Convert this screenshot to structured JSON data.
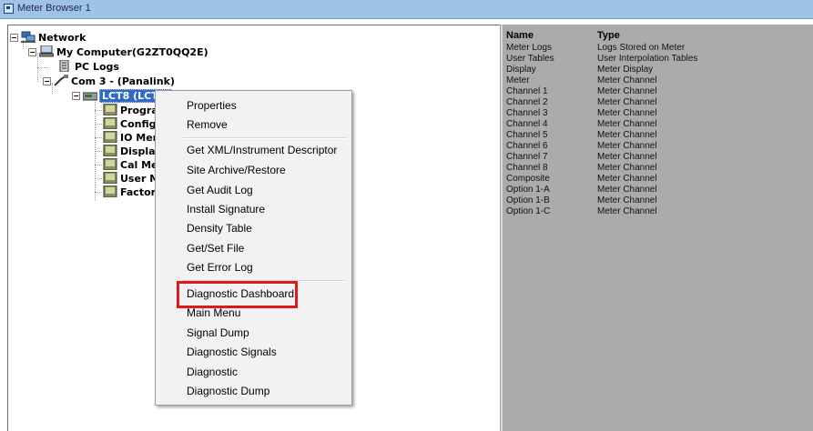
{
  "window": {
    "title": "Meter Browser 1"
  },
  "tree": {
    "network": "Network",
    "computer": "My Computer(G2ZT0QQ2E)",
    "pc_logs": "PC Logs",
    "com": "Com 3 -  (Panalink)",
    "lct": "LCT8 (LCT8)",
    "children": [
      "Progra",
      "Config",
      "IO Mer",
      "Display",
      "Cal Me",
      "User M",
      "Factor"
    ]
  },
  "list": {
    "header_name": "Name",
    "header_type": "Type",
    "rows": [
      {
        "name": "Meter Logs",
        "type": "Logs Stored on Meter"
      },
      {
        "name": "User Tables",
        "type": "User Interpolation Tables"
      },
      {
        "name": "Display",
        "type": "Meter Display"
      },
      {
        "name": "Meter",
        "type": "Meter Channel"
      },
      {
        "name": "Channel 1",
        "type": "Meter Channel"
      },
      {
        "name": "Channel 2",
        "type": "Meter Channel"
      },
      {
        "name": "Channel 3",
        "type": "Meter Channel"
      },
      {
        "name": "Channel 4",
        "type": "Meter Channel"
      },
      {
        "name": "Channel 5",
        "type": "Meter Channel"
      },
      {
        "name": "Channel 6",
        "type": "Meter Channel"
      },
      {
        "name": "Channel 7",
        "type": "Meter Channel"
      },
      {
        "name": "Channel 8",
        "type": "Meter Channel"
      },
      {
        "name": "Composite",
        "type": "Meter Channel"
      },
      {
        "name": "Option 1-A",
        "type": "Meter Channel"
      },
      {
        "name": "Option 1-B",
        "type": "Meter Channel"
      },
      {
        "name": "Option 1-C",
        "type": "Meter Channel"
      }
    ]
  },
  "menu": {
    "items": [
      "Properties",
      "Remove",
      "Get XML/Instrument Descriptor",
      "Site Archive/Restore",
      "Get Audit Log",
      "Install Signature",
      "Density Table",
      "Get/Set File",
      "Get Error Log",
      "Diagnostic Dashboard",
      "Main Menu",
      "Signal Dump",
      "Diagnostic Signals",
      "Diagnostic",
      "Diagnostic Dump"
    ]
  },
  "colors": {
    "selection": "#3169c6",
    "highlight": "#e01818",
    "right_pane": "#ababab"
  }
}
